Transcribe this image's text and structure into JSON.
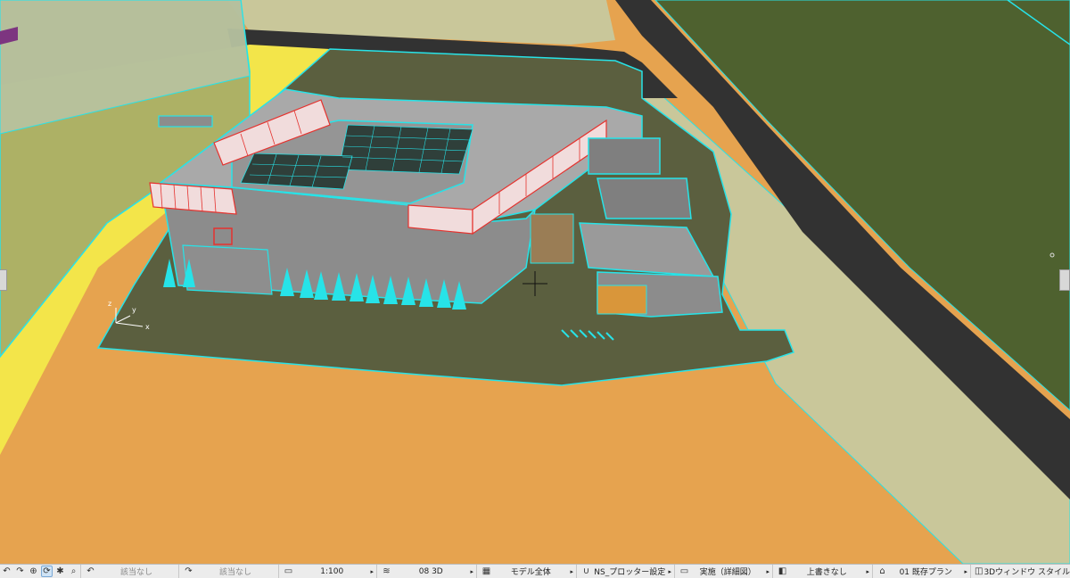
{
  "canvas": {
    "axis_labels": {
      "z": "z",
      "y": "y",
      "x": "x"
    },
    "colors": {
      "ground_orange": "#e6a34f",
      "road": "#323232",
      "grass": "#4e612f",
      "site": "#5b5f3f",
      "building_gray": "#8c8c8c",
      "selection_outline": "#27e3e8",
      "railing_red": "#e5322e"
    }
  },
  "statusbar": {
    "undo_icon": "undo-icon",
    "redo_icon": "redo-icon",
    "zoom_in_icon": "zoom-in-icon",
    "orbit_icon": "orbit-icon",
    "walk_icon": "walk-icon",
    "zoom_icon": "zoom-icon",
    "field_1": "該当なし",
    "field_2": "該当なし",
    "scale": "1:100",
    "layer_combo": "08 3D",
    "model_view": "モデル全体",
    "pen_set": "NS_プロッター設定",
    "mvo": "実施（詳細図）",
    "override": "上書きなし",
    "renovation": "01 既存プラン",
    "window_style": "3Dウィンドウ スタイル"
  }
}
